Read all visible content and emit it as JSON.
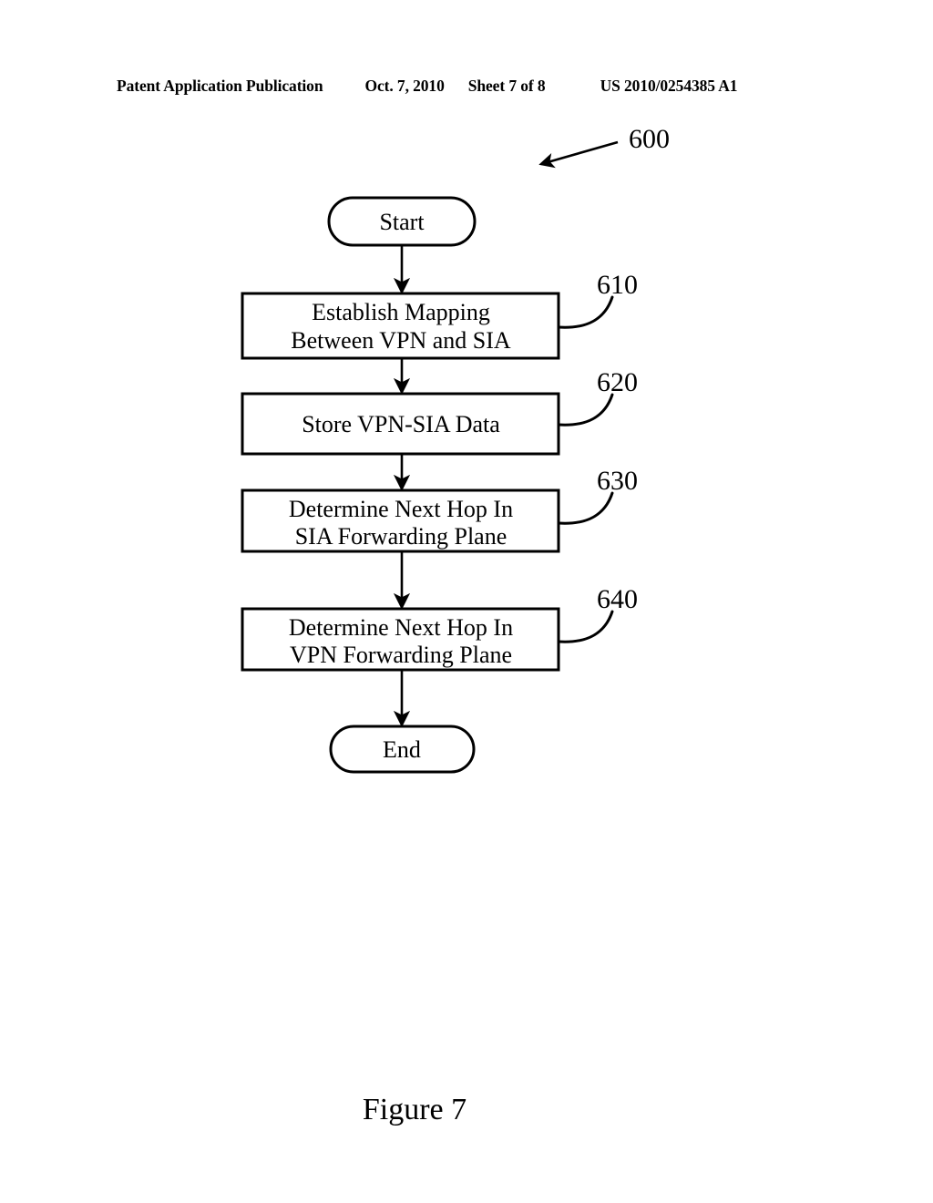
{
  "header": {
    "publication": "Patent Application Publication",
    "date": "Oct. 7, 2010",
    "sheet": "Sheet 7 of 8",
    "patent_number": "US 2010/0254385 A1"
  },
  "figure": {
    "caption": "Figure 7",
    "diagram_reference": "600"
  },
  "flowchart": {
    "type": "flowchart",
    "orientation": "top-to-bottom",
    "nodes": [
      {
        "id": "start",
        "shape": "terminal",
        "label": "Start",
        "ref": ""
      },
      {
        "id": "step-610",
        "shape": "process",
        "label_line1": "Establish Mapping",
        "label_line2": "Between VPN and SIA",
        "ref": "610"
      },
      {
        "id": "step-620",
        "shape": "process",
        "label_line1": "Store VPN-SIA Data",
        "label_line2": "",
        "ref": "620"
      },
      {
        "id": "step-630",
        "shape": "process",
        "label_line1": "Determine Next Hop In",
        "label_line2": "SIA Forwarding Plane",
        "ref": "630"
      },
      {
        "id": "step-640",
        "shape": "process",
        "label_line1": "Determine Next Hop In",
        "label_line2": "VPN Forwarding Plane",
        "ref": "640"
      },
      {
        "id": "end",
        "shape": "terminal",
        "label": "End",
        "ref": ""
      }
    ],
    "edges": [
      {
        "from": "start",
        "to": "step-610"
      },
      {
        "from": "step-610",
        "to": "step-620"
      },
      {
        "from": "step-620",
        "to": "step-630"
      },
      {
        "from": "step-630",
        "to": "step-640"
      },
      {
        "from": "step-640",
        "to": "end"
      }
    ],
    "colors": {
      "line": "#000000",
      "fill": "#ffffff",
      "background": "#ffffff"
    }
  }
}
